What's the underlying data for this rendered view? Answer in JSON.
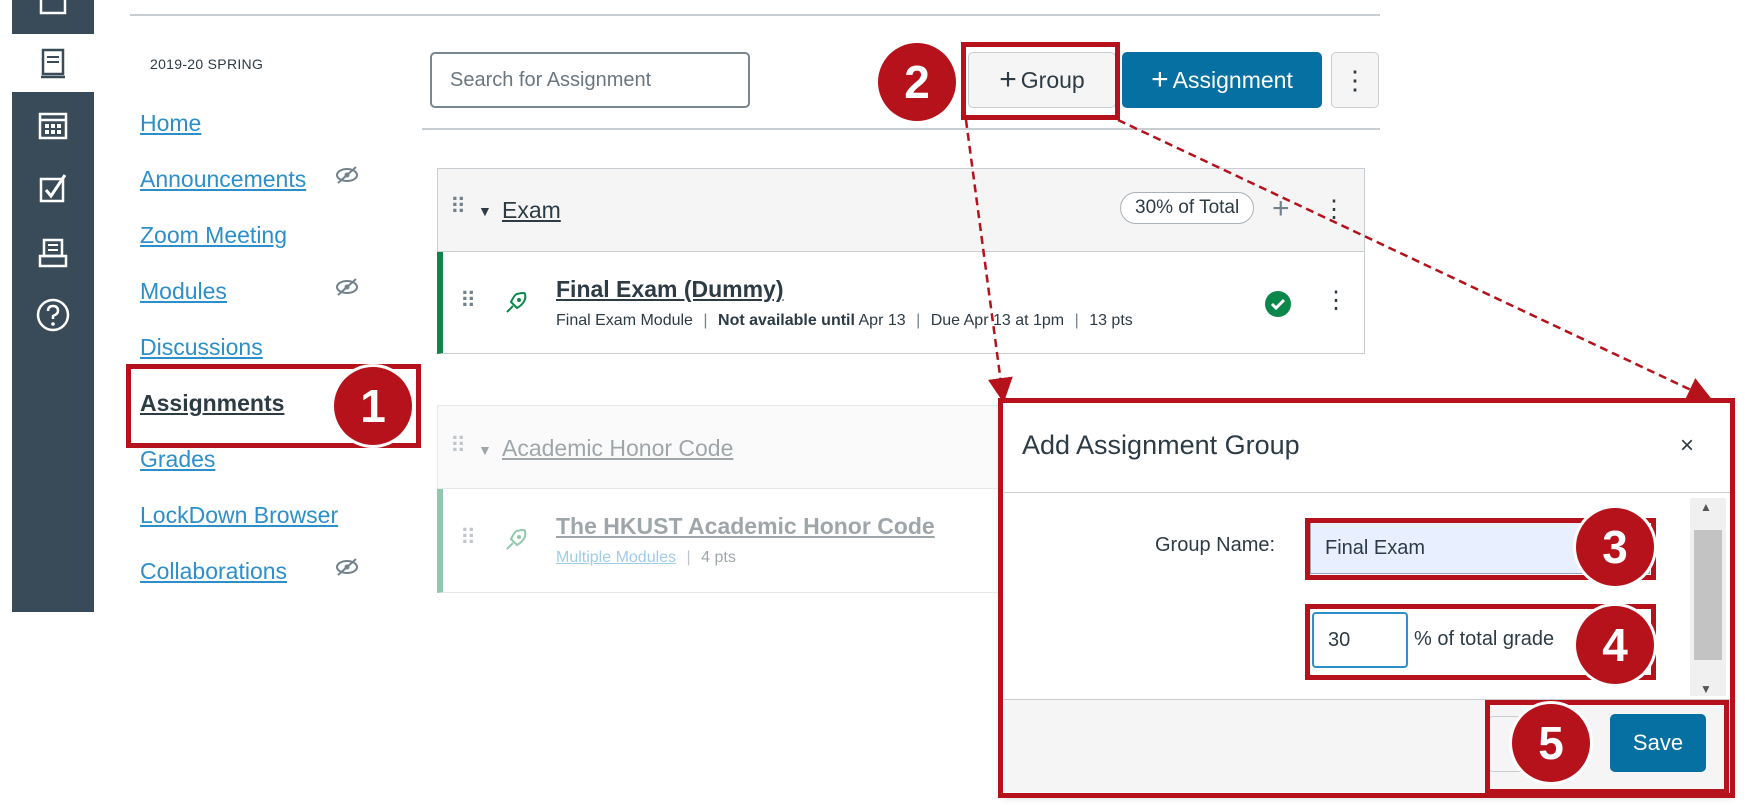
{
  "term": "2019-20 SPRING",
  "global_nav": {
    "items": [
      {
        "icon": "dashboard-icon"
      },
      {
        "icon": "courses-icon",
        "active": true
      },
      {
        "icon": "calendar-icon"
      },
      {
        "icon": "todo-checkbox-icon"
      },
      {
        "icon": "inbox-icon"
      },
      {
        "icon": "help-icon"
      }
    ]
  },
  "course_nav": {
    "items": [
      {
        "label": "Home"
      },
      {
        "label": "Announcements",
        "hidden_icon": "eye-slash-icon"
      },
      {
        "label": "Zoom Meeting"
      },
      {
        "label": "Modules",
        "hidden_icon": "eye-slash-icon"
      },
      {
        "label": "Discussions"
      },
      {
        "label": "Assignments",
        "active": true
      },
      {
        "label": "Grades"
      },
      {
        "label": "LockDown Browser"
      },
      {
        "label": "Collaborations",
        "hidden_icon": "eye-slash-icon"
      }
    ]
  },
  "toolbar": {
    "search_placeholder": "Search for Assignment",
    "group_button": "Group",
    "assignment_button": "Assignment",
    "plus": "+",
    "kebab": "⋮"
  },
  "groups": [
    {
      "title": "Exam",
      "weight": "30% of Total",
      "assignments": [
        {
          "title": "Final Exam (Dummy)",
          "module": "Final Exam Module",
          "availability_bold": "Not available until",
          "availability_date": "Apr 13",
          "due": "Due Apr 13 at 1pm",
          "points": "13 pts",
          "published": true
        }
      ]
    },
    {
      "title": "Academic Honor Code",
      "assignments": [
        {
          "title": "The HKUST Academic Honor Code",
          "module_link": "Multiple Modules",
          "points": "4 pts"
        }
      ]
    }
  ],
  "dialog": {
    "title": "Add Assignment Group",
    "close": "×",
    "group_name_label": "Group Name:",
    "group_name_value": "Final Exam",
    "weight_value": "30",
    "weight_suffix": "% of total grade",
    "save_button": "Save"
  },
  "callouts": [
    "1",
    "2",
    "3",
    "4",
    "5"
  ],
  "colors": {
    "callout_red": "#b5121b",
    "link_blue": "#2d8fc9",
    "button_blue": "#0770a3",
    "nav_dark": "#394b58",
    "success_green": "#0b874b"
  }
}
